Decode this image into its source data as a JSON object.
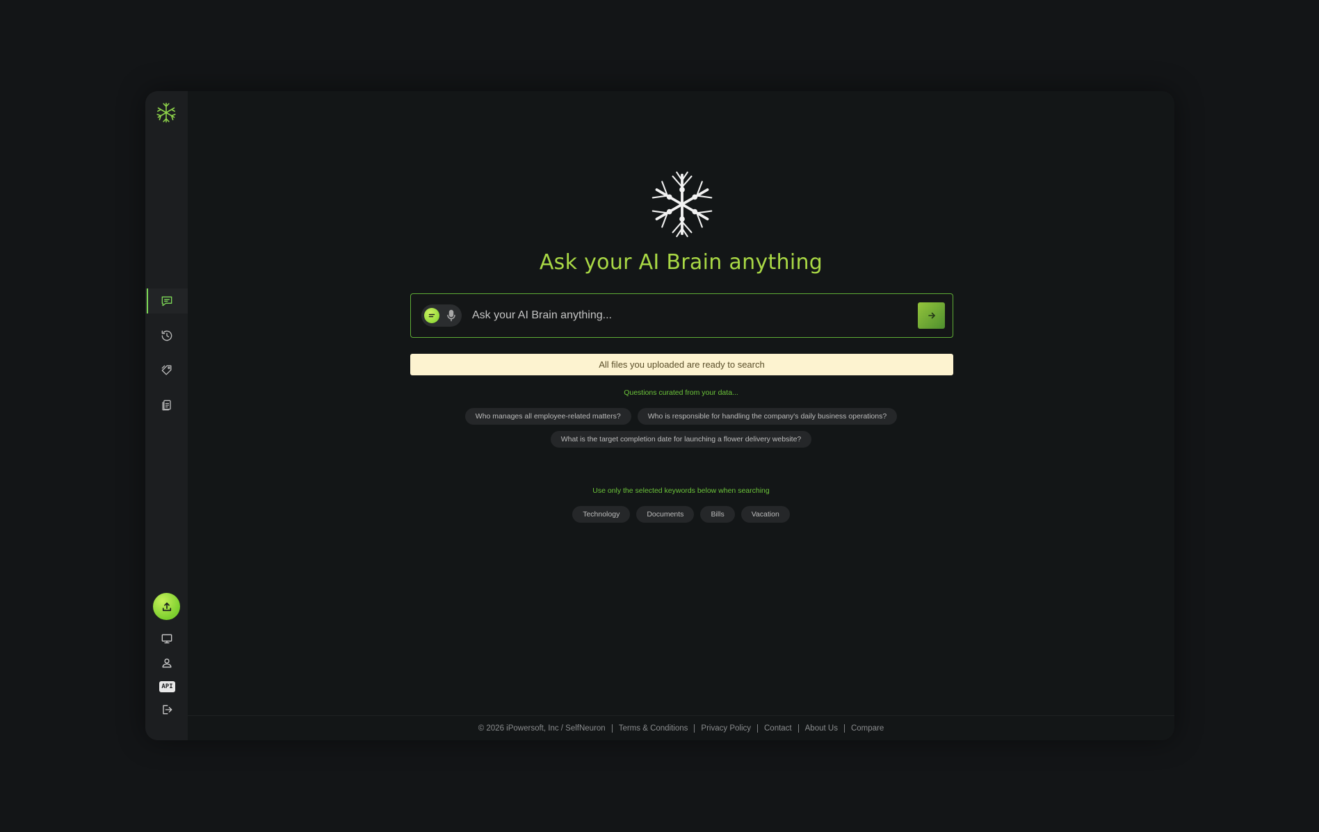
{
  "headline": "Ask your AI Brain anything",
  "search": {
    "placeholder": "Ask your AI Brain anything...",
    "value": ""
  },
  "notice": "All files you uploaded are ready to search",
  "questions": {
    "label": "Questions curated from your data...",
    "items": [
      "Who manages all employee-related matters?",
      "Who is responsible for handling the company's daily business operations?",
      "What is the target completion date for launching a flower delivery website?"
    ]
  },
  "keywords": {
    "label": "Use only the selected keywords below when searching",
    "items": [
      "Technology",
      "Documents",
      "Bills",
      "Vacation"
    ]
  },
  "sidebar": {
    "nav": [
      {
        "icon": "chat-icon",
        "active": true
      },
      {
        "icon": "history-icon",
        "active": false
      },
      {
        "icon": "tag-icon",
        "active": false
      },
      {
        "icon": "documents-icon",
        "active": false
      }
    ],
    "bottom": [
      "upload-icon",
      "monitor-icon",
      "user-icon",
      "api-icon",
      "logout-icon"
    ],
    "api_label": "API"
  },
  "footer": {
    "copyright": "© 2026 iPowersoft, Inc / SelfNeuron",
    "links": [
      "Terms & Conditions",
      "Privacy Policy",
      "Contact",
      "About Us",
      "Compare"
    ]
  },
  "colors": {
    "accent": "#7ed957",
    "headline": "#a9d845",
    "notice_bg": "#fdf3d0",
    "background": "#131517"
  }
}
